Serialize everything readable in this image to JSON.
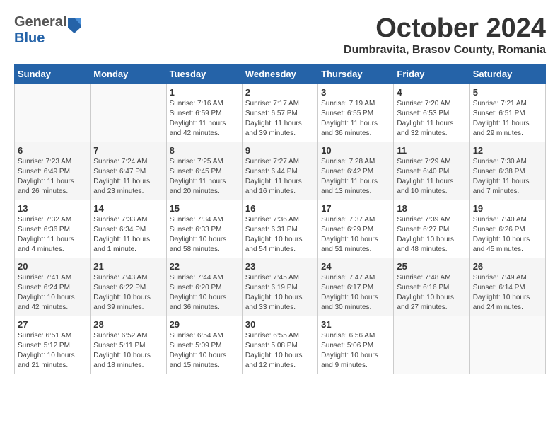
{
  "header": {
    "logo_general": "General",
    "logo_blue": "Blue",
    "month_title": "October 2024",
    "location": "Dumbravita, Brasov County, Romania"
  },
  "weekdays": [
    "Sunday",
    "Monday",
    "Tuesday",
    "Wednesday",
    "Thursday",
    "Friday",
    "Saturday"
  ],
  "weeks": [
    [
      {
        "day": "",
        "info": ""
      },
      {
        "day": "",
        "info": ""
      },
      {
        "day": "1",
        "info": "Sunrise: 7:16 AM\nSunset: 6:59 PM\nDaylight: 11 hours and 42 minutes."
      },
      {
        "day": "2",
        "info": "Sunrise: 7:17 AM\nSunset: 6:57 PM\nDaylight: 11 hours and 39 minutes."
      },
      {
        "day": "3",
        "info": "Sunrise: 7:19 AM\nSunset: 6:55 PM\nDaylight: 11 hours and 36 minutes."
      },
      {
        "day": "4",
        "info": "Sunrise: 7:20 AM\nSunset: 6:53 PM\nDaylight: 11 hours and 32 minutes."
      },
      {
        "day": "5",
        "info": "Sunrise: 7:21 AM\nSunset: 6:51 PM\nDaylight: 11 hours and 29 minutes."
      }
    ],
    [
      {
        "day": "6",
        "info": "Sunrise: 7:23 AM\nSunset: 6:49 PM\nDaylight: 11 hours and 26 minutes."
      },
      {
        "day": "7",
        "info": "Sunrise: 7:24 AM\nSunset: 6:47 PM\nDaylight: 11 hours and 23 minutes."
      },
      {
        "day": "8",
        "info": "Sunrise: 7:25 AM\nSunset: 6:45 PM\nDaylight: 11 hours and 20 minutes."
      },
      {
        "day": "9",
        "info": "Sunrise: 7:27 AM\nSunset: 6:44 PM\nDaylight: 11 hours and 16 minutes."
      },
      {
        "day": "10",
        "info": "Sunrise: 7:28 AM\nSunset: 6:42 PM\nDaylight: 11 hours and 13 minutes."
      },
      {
        "day": "11",
        "info": "Sunrise: 7:29 AM\nSunset: 6:40 PM\nDaylight: 11 hours and 10 minutes."
      },
      {
        "day": "12",
        "info": "Sunrise: 7:30 AM\nSunset: 6:38 PM\nDaylight: 11 hours and 7 minutes."
      }
    ],
    [
      {
        "day": "13",
        "info": "Sunrise: 7:32 AM\nSunset: 6:36 PM\nDaylight: 11 hours and 4 minutes."
      },
      {
        "day": "14",
        "info": "Sunrise: 7:33 AM\nSunset: 6:34 PM\nDaylight: 11 hours and 1 minute."
      },
      {
        "day": "15",
        "info": "Sunrise: 7:34 AM\nSunset: 6:33 PM\nDaylight: 10 hours and 58 minutes."
      },
      {
        "day": "16",
        "info": "Sunrise: 7:36 AM\nSunset: 6:31 PM\nDaylight: 10 hours and 54 minutes."
      },
      {
        "day": "17",
        "info": "Sunrise: 7:37 AM\nSunset: 6:29 PM\nDaylight: 10 hours and 51 minutes."
      },
      {
        "day": "18",
        "info": "Sunrise: 7:39 AM\nSunset: 6:27 PM\nDaylight: 10 hours and 48 minutes."
      },
      {
        "day": "19",
        "info": "Sunrise: 7:40 AM\nSunset: 6:26 PM\nDaylight: 10 hours and 45 minutes."
      }
    ],
    [
      {
        "day": "20",
        "info": "Sunrise: 7:41 AM\nSunset: 6:24 PM\nDaylight: 10 hours and 42 minutes."
      },
      {
        "day": "21",
        "info": "Sunrise: 7:43 AM\nSunset: 6:22 PM\nDaylight: 10 hours and 39 minutes."
      },
      {
        "day": "22",
        "info": "Sunrise: 7:44 AM\nSunset: 6:20 PM\nDaylight: 10 hours and 36 minutes."
      },
      {
        "day": "23",
        "info": "Sunrise: 7:45 AM\nSunset: 6:19 PM\nDaylight: 10 hours and 33 minutes."
      },
      {
        "day": "24",
        "info": "Sunrise: 7:47 AM\nSunset: 6:17 PM\nDaylight: 10 hours and 30 minutes."
      },
      {
        "day": "25",
        "info": "Sunrise: 7:48 AM\nSunset: 6:16 PM\nDaylight: 10 hours and 27 minutes."
      },
      {
        "day": "26",
        "info": "Sunrise: 7:49 AM\nSunset: 6:14 PM\nDaylight: 10 hours and 24 minutes."
      }
    ],
    [
      {
        "day": "27",
        "info": "Sunrise: 6:51 AM\nSunset: 5:12 PM\nDaylight: 10 hours and 21 minutes."
      },
      {
        "day": "28",
        "info": "Sunrise: 6:52 AM\nSunset: 5:11 PM\nDaylight: 10 hours and 18 minutes."
      },
      {
        "day": "29",
        "info": "Sunrise: 6:54 AM\nSunset: 5:09 PM\nDaylight: 10 hours and 15 minutes."
      },
      {
        "day": "30",
        "info": "Sunrise: 6:55 AM\nSunset: 5:08 PM\nDaylight: 10 hours and 12 minutes."
      },
      {
        "day": "31",
        "info": "Sunrise: 6:56 AM\nSunset: 5:06 PM\nDaylight: 10 hours and 9 minutes."
      },
      {
        "day": "",
        "info": ""
      },
      {
        "day": "",
        "info": ""
      }
    ]
  ]
}
